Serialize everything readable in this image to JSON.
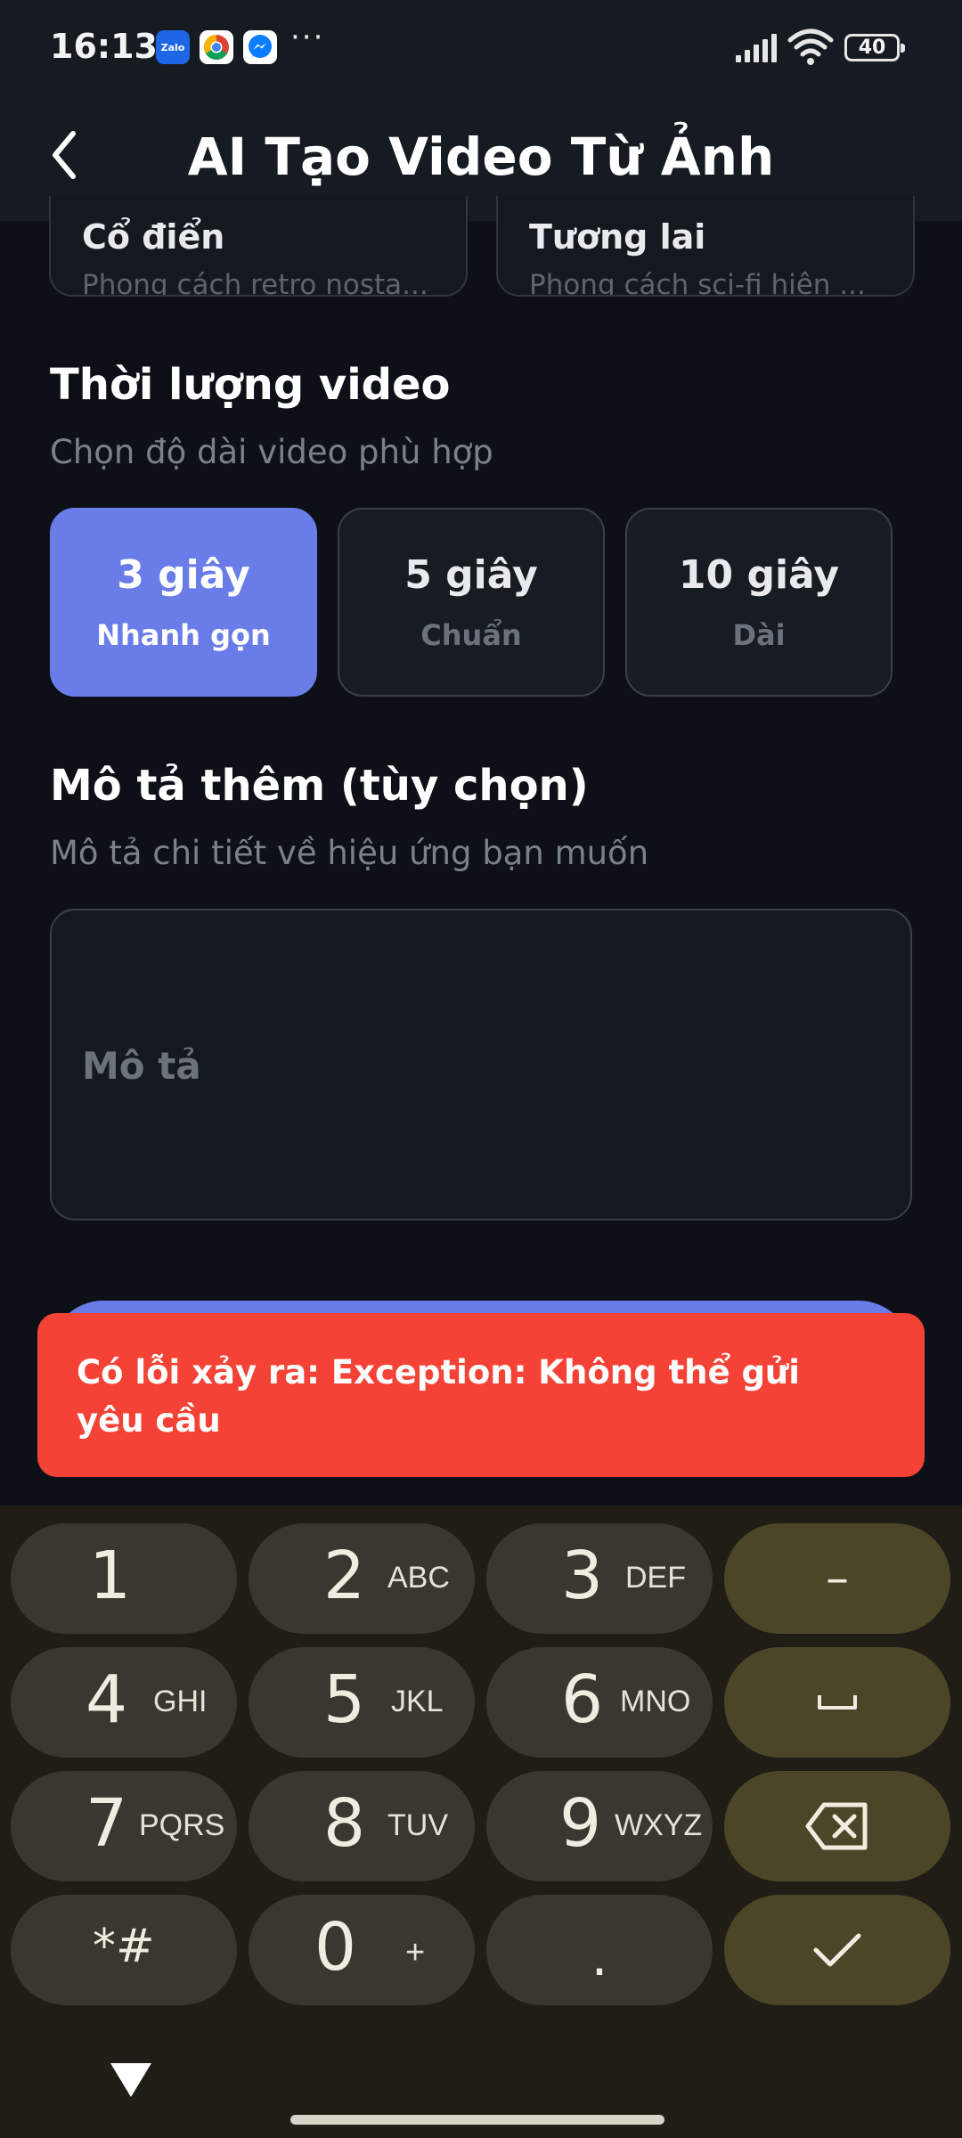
{
  "status_bar": {
    "time": "16:13",
    "apps": [
      "Zalo",
      "Chrome",
      "Messenger"
    ],
    "more": "···",
    "battery": "40"
  },
  "header": {
    "title": "AI Tạo Video Từ Ảnh"
  },
  "styles": [
    {
      "name": "Cổ điển",
      "description": "Phong cách retro nosta..."
    },
    {
      "name": "Tương lai",
      "description": "Phong cách sci-fi hiện ..."
    }
  ],
  "duration": {
    "title": "Thời lượng video",
    "subtitle": "Chọn độ dài video phù hợp",
    "options": [
      {
        "label": "3 giây",
        "sub": "Nhanh gọn",
        "selected": true
      },
      {
        "label": "5 giây",
        "sub": "Chuẩn",
        "selected": false
      },
      {
        "label": "10 giây",
        "sub": "Dài",
        "selected": false
      }
    ]
  },
  "description": {
    "title": "Mô tả thêm (tùy chọn)",
    "subtitle": "Mô tả chi tiết về hiệu ứng bạn muốn",
    "placeholder": "Mô tả"
  },
  "error_toast": {
    "message": "Có lỗi xảy ra: Exception: Không thể gửi yêu cầu"
  },
  "keypad": {
    "keys": [
      {
        "digit": "1",
        "letters": ""
      },
      {
        "digit": "2",
        "letters": "ABC"
      },
      {
        "digit": "3",
        "letters": "DEF"
      },
      {
        "digit": "4",
        "letters": "GHI"
      },
      {
        "digit": "5",
        "letters": "JKL"
      },
      {
        "digit": "6",
        "letters": "MNO"
      },
      {
        "digit": "7",
        "letters": "PQRS"
      },
      {
        "digit": "8",
        "letters": "TUV"
      },
      {
        "digit": "9",
        "letters": "WXYZ"
      },
      {
        "digit": "*#",
        "letters": ""
      },
      {
        "digit": "0",
        "letters": "+"
      },
      {
        "digit": ".",
        "letters": ""
      }
    ],
    "minus": "–",
    "icons": [
      "space-icon",
      "backspace-icon",
      "check-icon",
      "collapse-keyboard-icon"
    ]
  },
  "colors": {
    "background": "#0d1117",
    "accent": "#6a7ce8",
    "error": "#f44336",
    "keypad_bg": "#201d16",
    "key_bg": "#3a3730",
    "action_key_bg": "#4c4628"
  }
}
